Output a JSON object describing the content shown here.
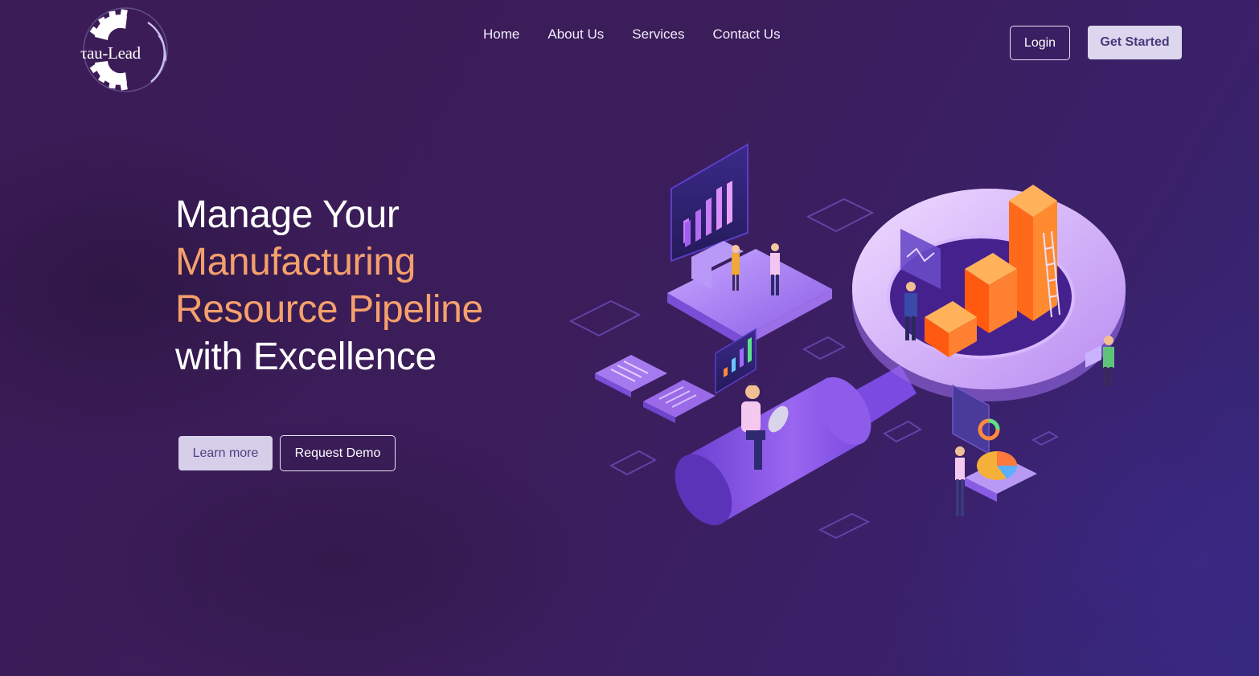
{
  "brand": {
    "logo_text": "τau-Lead"
  },
  "nav": {
    "items": [
      {
        "label": "Home"
      },
      {
        "label": "About Us"
      },
      {
        "label": "Services"
      },
      {
        "label": "Contact Us"
      }
    ]
  },
  "header_actions": {
    "login_label": "Login",
    "get_started_label": "Get Started"
  },
  "hero": {
    "title_line1": "Manage Your",
    "title_line2": "Manufacturing",
    "title_line3": "Resource Pipeline",
    "title_line4": "with Excellence",
    "learn_more_label": "Learn more",
    "request_demo_label": "Request Demo"
  },
  "colors": {
    "background": "#3c1c56",
    "accent_text": "#f5a06c",
    "button_light": "#dcd6ee",
    "illustration_purple": "#8a5ce6",
    "illustration_orange": "#ff6a1a"
  },
  "icons": {
    "logo": "gear-icon",
    "illustration": "manufacturing-analytics-illustration"
  }
}
